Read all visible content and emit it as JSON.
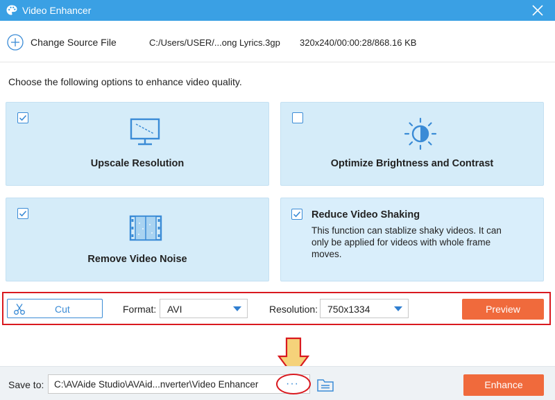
{
  "window": {
    "title": "Video Enhancer"
  },
  "source": {
    "change_label": "Change Source File",
    "path": "C:/Users/USER/...ong Lyrics.3gp",
    "info": "320x240/00:00:28/868.16 KB"
  },
  "instruction": "Choose the following options to enhance video quality.",
  "options": [
    {
      "label": "Upscale Resolution",
      "checked": true,
      "icon": "monitor-icon"
    },
    {
      "label": "Optimize Brightness and Contrast",
      "checked": false,
      "icon": "brightness-icon"
    },
    {
      "label": "Remove Video Noise",
      "checked": true,
      "icon": "film-icon"
    },
    {
      "label": "Reduce Video Shaking",
      "checked": true,
      "description": "This function can stablize shaky videos. It can only be applied for videos with whole frame moves."
    }
  ],
  "toolbar": {
    "cut_label": "Cut",
    "format_label": "Format:",
    "format_value": "AVI",
    "resolution_label": "Resolution:",
    "resolution_value": "750x1334",
    "preview_label": "Preview"
  },
  "bottom": {
    "save_label": "Save to:",
    "save_path": "C:\\AVAide Studio\\AVAid...nverter\\Video Enhancer",
    "more_label": "···",
    "enhance_label": "Enhance"
  },
  "colors": {
    "titlebar": "#3aa0e4",
    "card_bg": "#d5ecf9",
    "accent_blue": "#3a8bd6",
    "button_orange": "#f06a3c",
    "highlight_red": "#d9191f",
    "arrow_fill": "#f5d27a"
  }
}
